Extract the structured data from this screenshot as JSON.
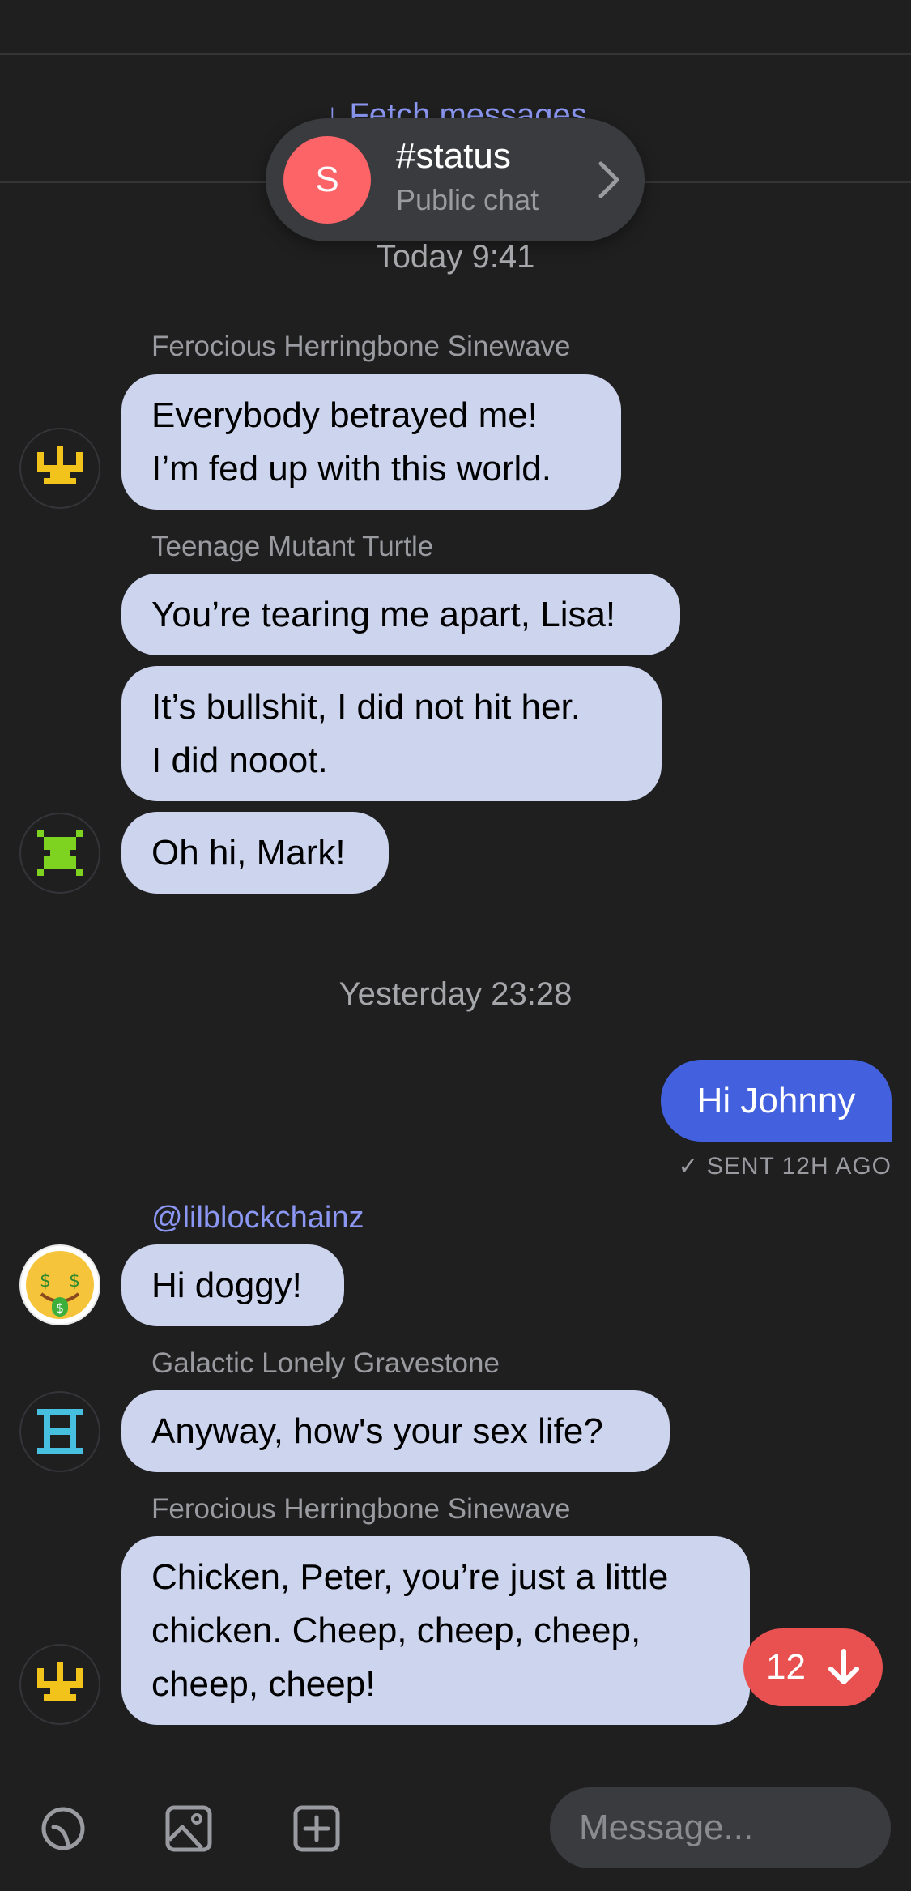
{
  "chat": {
    "fetch_label": "↓ Fetch messages",
    "header": {
      "avatar_letter": "S",
      "title": "#status",
      "subtitle": "Public chat",
      "avatar_color": "#fd6468"
    },
    "date_separators": [
      {
        "day": "Today",
        "time": "9:41"
      },
      {
        "day": "Yesterday",
        "time": "23:28"
      }
    ],
    "senders": {
      "s1": "Ferocious Herringbone Sinewave",
      "s2": "Teenage Mutant Turtle",
      "s3": "@lilblockchainz",
      "s4": "Galactic Lonely Gravestone",
      "s5": "Ferocious Herringbone Sinewave"
    },
    "messages": {
      "m1": [
        "Everybody betrayed me!",
        "I’m fed up with this world."
      ],
      "m2": [
        "You’re tearing me apart, Lisa!"
      ],
      "m3": [
        "It’s bullshit, I did not hit her.",
        "I did nooot."
      ],
      "m4": [
        "Oh hi, Mark!"
      ],
      "m5": [
        "Hi doggy!"
      ],
      "m6": [
        "Anyway, how's your sex life?"
      ],
      "m7": [
        "Chicken, Peter, you’re just a little",
        "chicken. Cheep, cheep, cheep,",
        "cheep, cheep!"
      ]
    },
    "outgoing": {
      "text": "Hi Johnny",
      "status": "✓ SENT 12H AGO"
    },
    "unread_count": "12",
    "input_placeholder": "Message...",
    "colors": {
      "background": "#1f1f20",
      "incoming_bubble": "#ccd4ee",
      "outgoing_bubble": "#4360df",
      "accent_link": "#8b97f2",
      "unread_badge": "#e95151"
    },
    "icons": [
      "sticker-icon",
      "image-icon",
      "add-icon",
      "chevron-right-icon",
      "arrow-down-icon"
    ]
  }
}
